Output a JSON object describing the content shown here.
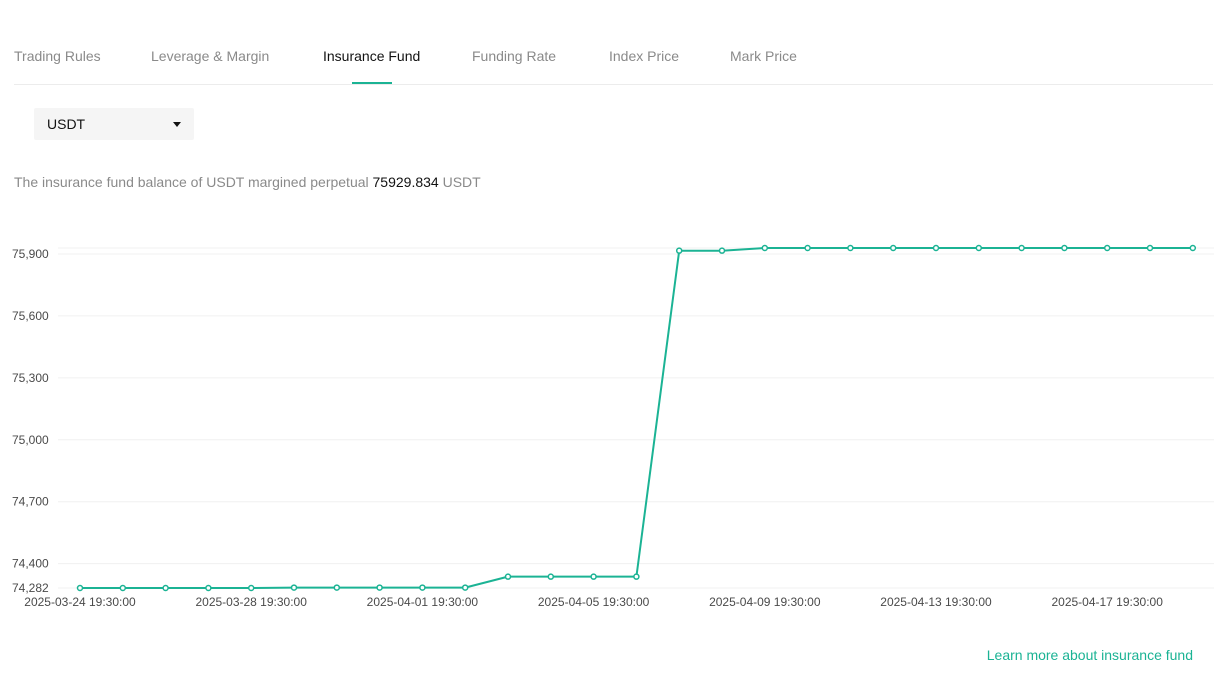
{
  "tabs": [
    {
      "label": "Trading Rules",
      "active": false
    },
    {
      "label": "Leverage & Margin",
      "active": false
    },
    {
      "label": "Insurance Fund",
      "active": true
    },
    {
      "label": "Funding Rate",
      "active": false
    },
    {
      "label": "Index Price",
      "active": false
    },
    {
      "label": "Mark Price",
      "active": false
    }
  ],
  "currency_select": {
    "value": "USDT",
    "icon": "caret-down-icon"
  },
  "balance": {
    "prefix": "The insurance fund balance of USDT margined perpetual",
    "amount": "75929.834",
    "unit": "USDT"
  },
  "learn_more": "Learn more about insurance fund",
  "colors": {
    "accent": "#1bb394",
    "grid": "#f0f0f0",
    "muted": "#8a8a8a",
    "text": "#121212"
  },
  "chart_data": {
    "type": "line",
    "title": "",
    "xlabel": "",
    "ylabel": "",
    "ylim": [
      74282,
      75929
    ],
    "y_ticks": [
      74282,
      74400,
      74700,
      75000,
      75300,
      75600,
      75900
    ],
    "y_tick_labels": [
      "74,282",
      "74,400",
      "74,700",
      "75,000",
      "75,300",
      "75,600",
      "75,900"
    ],
    "x_tick_labels": [
      "2025-03-24 19:30:00",
      "2025-03-28 19:30:00",
      "2025-04-01 19:30:00",
      "2025-04-05 19:30:00",
      "2025-04-09 19:30:00",
      "2025-04-13 19:30:00",
      "2025-04-17 19:30:00"
    ],
    "x": [
      "2025-03-24 19:30:00",
      "2025-03-25 19:30:00",
      "2025-03-26 19:30:00",
      "2025-03-27 19:30:00",
      "2025-03-28 19:30:00",
      "2025-03-29 19:30:00",
      "2025-03-30 19:30:00",
      "2025-03-31 19:30:00",
      "2025-04-01 19:30:00",
      "2025-04-02 19:30:00",
      "2025-04-03 19:30:00",
      "2025-04-04 19:30:00",
      "2025-04-05 19:30:00",
      "2025-04-06 19:30:00",
      "2025-04-07 19:30:00",
      "2025-04-08 19:30:00",
      "2025-04-09 19:30:00",
      "2025-04-10 19:30:00",
      "2025-04-11 19:30:00",
      "2025-04-12 19:30:00",
      "2025-04-13 19:30:00",
      "2025-04-14 19:30:00",
      "2025-04-15 19:30:00",
      "2025-04-16 19:30:00",
      "2025-04-17 19:30:00",
      "2025-04-18 19:30:00",
      "2025-04-19 19:30:00"
    ],
    "series": [
      {
        "values": [
          74282,
          74282,
          74282,
          74282,
          74282,
          74284,
          74284,
          74284,
          74284,
          74284,
          74337,
          74337,
          74337,
          74337,
          75916,
          75916,
          75929,
          75929,
          75929,
          75929,
          75929,
          75929,
          75929,
          75929,
          75929,
          75929,
          75929
        ]
      }
    ],
    "grid": true,
    "legend": "none"
  }
}
